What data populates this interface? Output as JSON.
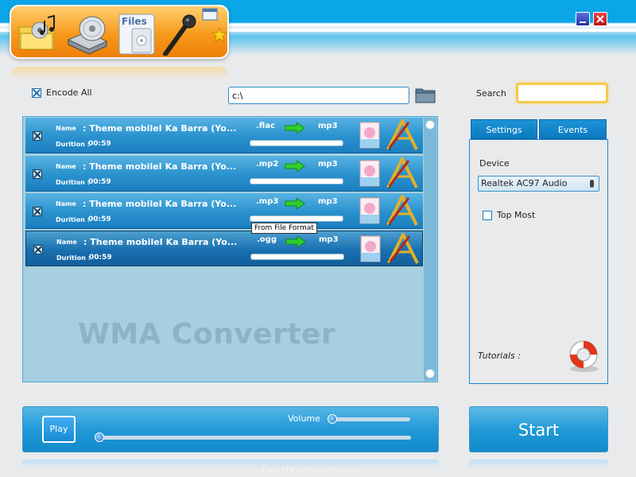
{
  "window": {
    "minimize_icon": "minimize-icon",
    "close_icon": "close-icon"
  },
  "toolbar": {
    "items": [
      {
        "name": "add-music-button",
        "icon": "music-folder-icon"
      },
      {
        "name": "add-cd-button",
        "icon": "cd-drive-icon"
      },
      {
        "name": "add-files-button",
        "icon": "files-icon",
        "label": "Files"
      },
      {
        "name": "record-button",
        "icon": "microphone-icon"
      }
    ],
    "accent": "#f69a1b"
  },
  "encode_all": {
    "label": "Encode All",
    "checked": true
  },
  "output_path": {
    "value": "c:\\"
  },
  "search": {
    "label": "Search",
    "value": ""
  },
  "file_list": {
    "rows": [
      {
        "name_label": "Name",
        "name": ": Theme mobileI Ka Barra (Yo...",
        "duration_label": "Durition :",
        "duration": "00:59",
        "from": ".flac",
        "to": "mp3",
        "checked": true
      },
      {
        "name_label": "Name",
        "name": ": Theme mobileI Ka Barra (Yo...",
        "duration_label": "Durition :",
        "duration": "00:59",
        "from": ".mp2",
        "to": "mp3",
        "checked": true
      },
      {
        "name_label": "Name",
        "name": ": Theme mobileI Ka Barra (Yo...",
        "duration_label": "Durition :",
        "duration": "00:59",
        "from": ".mp3",
        "to": "mp3",
        "checked": true
      },
      {
        "name_label": "Name",
        "name": ": Theme mobileI Ka Barra (Yo...",
        "duration_label": "Durition :",
        "duration": "00:59",
        "from": ".ogg",
        "to": "mp3",
        "checked": true
      }
    ],
    "watermark": "WMA Converter",
    "tooltip": "From File Format"
  },
  "settings": {
    "tabs": [
      {
        "label": "Settings"
      },
      {
        "label": "Events"
      }
    ],
    "device_label": "Device",
    "device_value": "Realtek AC97 Audio",
    "top_most": {
      "label": "Top Most",
      "checked": false
    },
    "tutorials_label": "Tutorials :"
  },
  "player": {
    "play_label": "Play",
    "volume_label": "Volume",
    "volume_level": 0,
    "seek_position": 0
  },
  "start": {
    "label": "Start"
  },
  "credit": "GearDownload.com"
}
